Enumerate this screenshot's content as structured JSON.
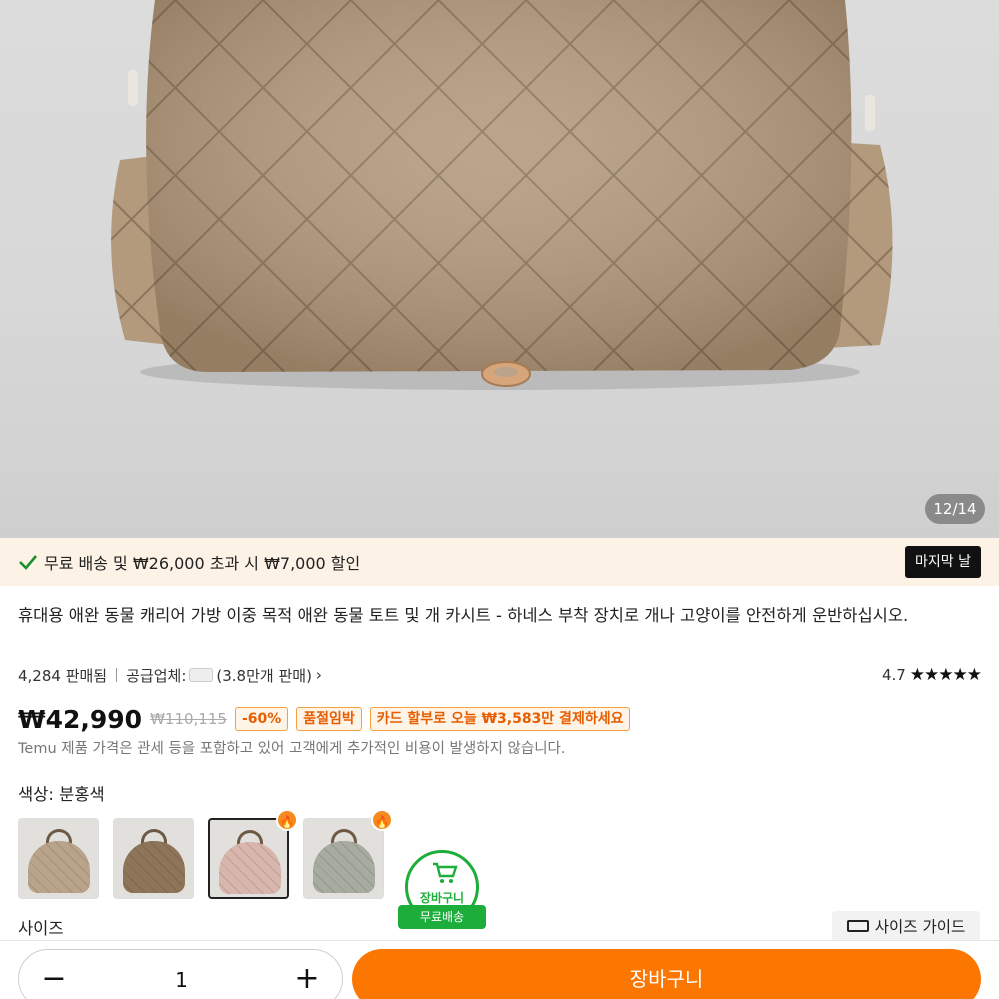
{
  "hero": {
    "image_counter": "12/14"
  },
  "promo": {
    "text": "무료 배송 및 ₩26,000 초과 시 ₩7,000 할인",
    "badge": "마지막 날",
    "check_icon": "check-icon"
  },
  "product": {
    "title": "휴대용 애완 동물 캐리어 가방 이중 목적 애완 동물 토트 및 개 카시트 - 하네스 부착 장치로 개나 고양이를 안전하게 운반하십시오.",
    "sold": "4,284 판매됨",
    "supplier_label": "공급업체:",
    "supplier_sales": "(3.8만개 판매)",
    "rating": "4.7",
    "rating_stars": 4.7,
    "price": "₩42,990",
    "original_price": "₩110,115",
    "discount": "-60%",
    "stock_tag": "품절임박",
    "installment_tag": "카드 할부로 오늘 ₩3,583만 결제하세요",
    "tax_note": "Temu 제품 가격은 관세 등을 포함하고 있어 고객에게 추가적인 비용이 발생하지 않습니다."
  },
  "color": {
    "label": "색상: 분홍색",
    "options": [
      {
        "name": "beige",
        "color": "#b9a48b",
        "selected": false,
        "hot": false
      },
      {
        "name": "brown",
        "color": "#8e7559",
        "selected": false,
        "hot": false
      },
      {
        "name": "pink",
        "color": "#d8b6ad",
        "selected": true,
        "hot": true
      },
      {
        "name": "gray-green",
        "color": "#a7aba0",
        "selected": false,
        "hot": true
      }
    ]
  },
  "cart_badge": {
    "text": "장바구니",
    "ribbon": "무료배송"
  },
  "size": {
    "label": "사이즈",
    "guide": "사이즈 가이드"
  },
  "bottom": {
    "quantity": "1",
    "minus": "−",
    "plus": "+",
    "add_to_cart": "장바구니"
  },
  "colors": {
    "accent": "#fb7701",
    "green": "#1dad3a",
    "tag_text": "#e65e00"
  }
}
